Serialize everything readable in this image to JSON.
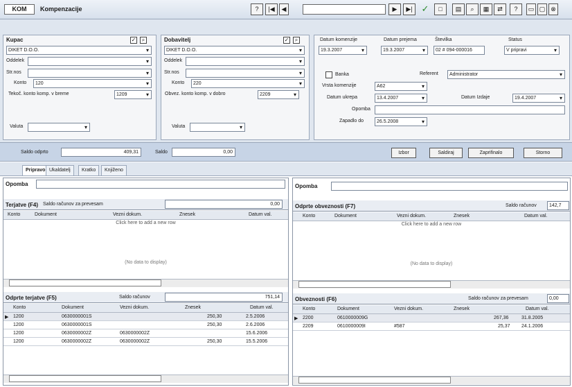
{
  "window": {
    "logo": "KOM",
    "title": "Kompenzacije",
    "toolbar": {
      "help": "?",
      "first": "|◀",
      "prev": "◀",
      "next": "▶",
      "last": "▶|",
      "ok": "✓",
      "new": "□",
      "b1": "▤",
      "b2": "⌕",
      "b3": "▦",
      "b4": "⇄",
      "b5": "?",
      "min": "▭",
      "max": "▢",
      "close": "⊗"
    }
  },
  "kupac": {
    "title": "Kupac",
    "partner": "DIKET D.O.O.",
    "odd_label": "Oddelek",
    "sr_label": "Str.nos",
    "konto_label": "Konto",
    "konto": "120",
    "tek_label": "Tekoč. konto komp. v breme",
    "tek": "1209",
    "valuta_label": "Valuta"
  },
  "dobavitelj": {
    "title": "Dobavitelj",
    "partner": "DIKET D.O.O.",
    "odd_label": "Oddelek",
    "sr_label": "Str.nos",
    "konto_label": "Konto",
    "konto": "220",
    "tek_label": "Obvez. konto komp. v dobro",
    "tek": "2209",
    "valuta_label": "Valuta"
  },
  "doc": {
    "dk_label": "Datum komenzije",
    "dk": "19.3.2007",
    "dp_label": "Datum prejema",
    "dp": "19.3.2007",
    "st_label": "Številka",
    "st": "02 # 094-000016",
    "status_label": "Status",
    "status": "V pripravi",
    "banka_label": "Banka",
    "ref_label": "Referent",
    "ref": "Administrator",
    "vk_label": "Vrsta komenzije",
    "vk": "A62",
    "dz_label": "Datum ukrepa",
    "dz": "13.4.2007",
    "dv_label": "Datum Izdaje",
    "dv": "19.4.2007",
    "op_label": "Opomba",
    "zap_label": "Zapadlo do",
    "zap": "26.5.2008"
  },
  "saldo": {
    "label": "Saldo odprto",
    "value": "409,31",
    "saldo2_label": "Saldo",
    "saldo2": "0,00"
  },
  "buttons": {
    "izbor": "Izbor",
    "saldiraj": "Saldiraj",
    "zapri": "Zaprifinalo",
    "storno": "Storno"
  },
  "tabs": [
    "Pripravo",
    "Ukaldatelj",
    "Kratko",
    "Knjiženo"
  ],
  "left": {
    "opomba_label": "Opomba",
    "top": {
      "title": "Terjatve (F4)",
      "saldo_label": "Saldo računov za prevesam",
      "saldo": "0,00",
      "cols": [
        "Konto",
        "Dokument",
        "Vezni dokum.",
        "Znesek",
        "Datum val."
      ],
      "hint": "Click here to add a new row",
      "nodata": "(No data to display)"
    },
    "bottom": {
      "title": "Odprte terjatve (F5)",
      "saldo_label": "Saldo računov",
      "saldo": "751,14",
      "cols": [
        "Konto",
        "Dokument",
        "Vezni dokum.",
        "Znesek",
        "Datum val."
      ],
      "rows": [
        [
          "1200",
          "0630000001S",
          "",
          "250,30",
          "2.5.2006"
        ],
        [
          "1200",
          "0630000001S",
          "",
          "250,30",
          "2.6.2006"
        ],
        [
          "1200",
          "0630000002Z",
          "0630000002Z",
          "",
          "15.6.2006"
        ],
        [
          "1200",
          "0630000002Z",
          "0630000002Z",
          "250,30",
          "15.5.2006"
        ]
      ]
    }
  },
  "right": {
    "opomba_label": "Opomba",
    "top": {
      "title": "Odprte obveznosti (F7)",
      "saldo_label": "Saldo računov",
      "saldo": "142,7",
      "cols": [
        "Konto",
        "Dokument",
        "Vezni dokum.",
        "Znesek",
        "Datum val."
      ],
      "hint": "Click here to add a new row",
      "nodata": "(No data to display)"
    },
    "bottom": {
      "title": "Obveznosti (F6)",
      "saldo_label": "Saldo računov za prevesam",
      "saldo": "0,00",
      "cols": [
        "Konto",
        "Dokument",
        "Vezni dokum.",
        "Znesek",
        "Datum val."
      ],
      "rows": [
        [
          "2200",
          "0610000009G",
          "",
          "267,36",
          "31.8.2005"
        ],
        [
          "2209",
          "0610000009I",
          "#587",
          "25,37",
          "24.1.2006"
        ]
      ]
    }
  }
}
